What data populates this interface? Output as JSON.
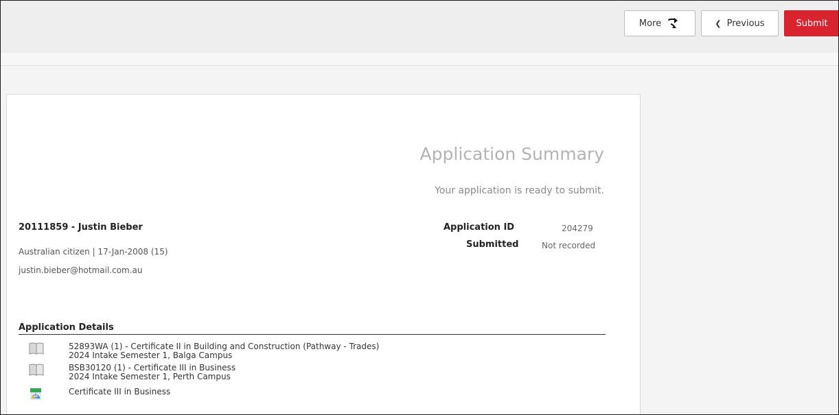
{
  "toolbar": {
    "more_label": "More",
    "previous_label": "Previous",
    "submit_label": "Submit"
  },
  "summary": {
    "title": "Application Summary",
    "subtitle": "Your application is ready to submit."
  },
  "applicant": {
    "name_line": "20111859 - Justin Bieber",
    "meta_line": "Australian citizen | 17-Jan-2008 (15)",
    "email": "justin.bieber@hotmail.com.au"
  },
  "application": {
    "id_label": "Application ID",
    "id_value": "204279",
    "submitted_label": "Submitted",
    "submitted_value": "Not recorded"
  },
  "details": {
    "title": "Application Details",
    "items": [
      {
        "icon": "book-icon",
        "line1": "52893WA (1) - Certificate II in Building and Construction (Pathway - Trades)",
        "line2": "2024 Intake Semester 1, Balga Campus"
      },
      {
        "icon": "book-icon",
        "line1": "BSB30120 (1) - Certificate III in Business",
        "line2": "2024 Intake Semester 1, Perth Campus"
      },
      {
        "icon": "structure-icon",
        "line1": "Certificate III in Business",
        "line2": ""
      }
    ]
  },
  "colors": {
    "submit_bg": "#d9232e",
    "title_color": "#b3b3b3",
    "subtitle_color": "#8a8a8a"
  }
}
